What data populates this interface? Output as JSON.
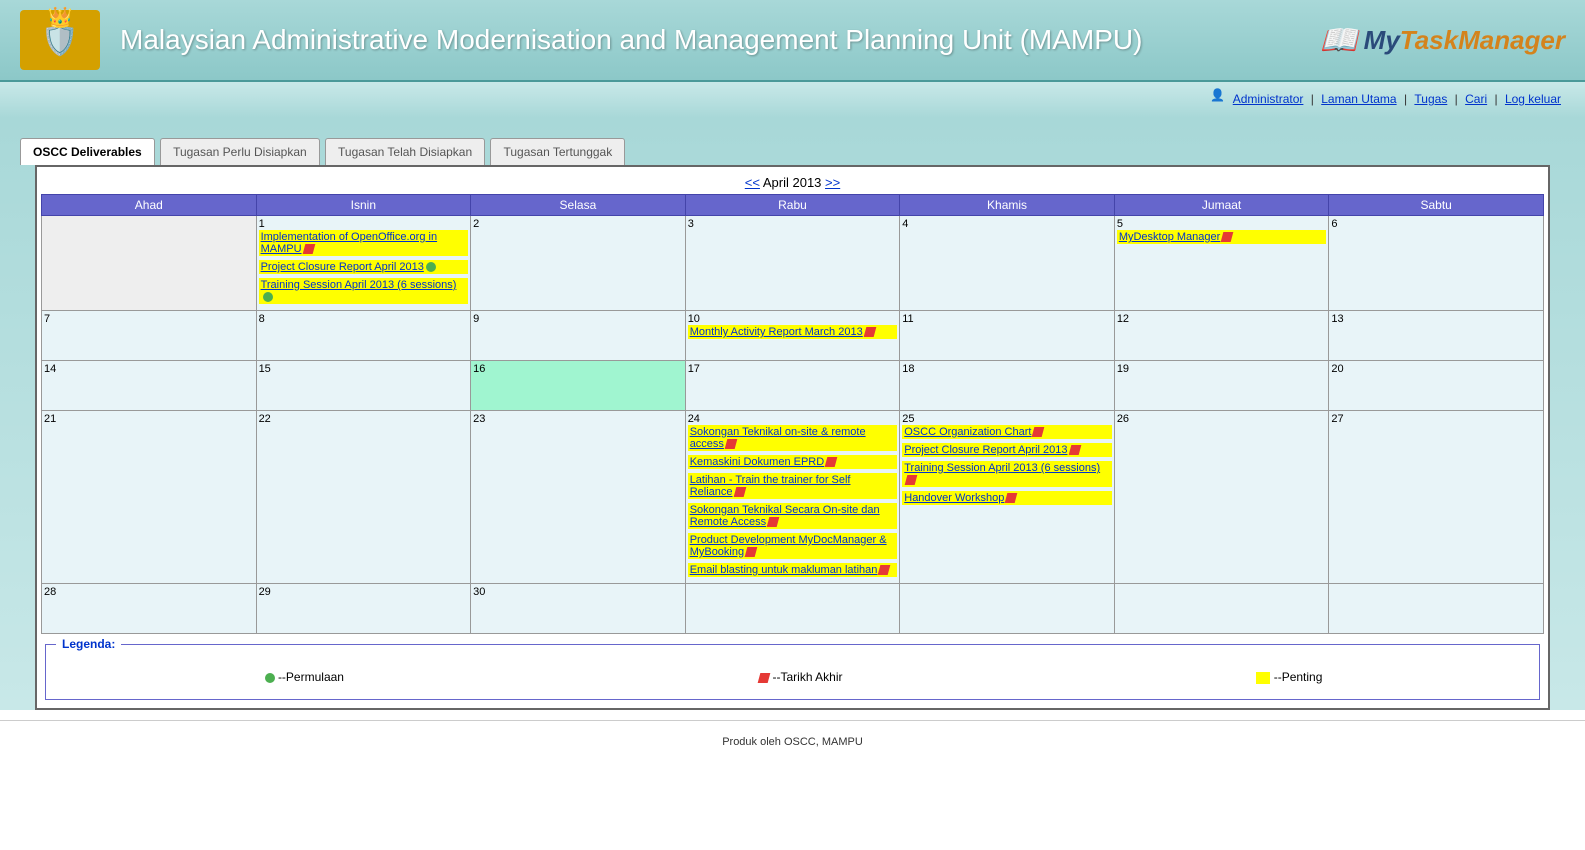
{
  "header": {
    "title": "Malaysian Administrative Modernisation and Management Planning Unit (MAMPU)",
    "logo_my": "My",
    "logo_task": "Task",
    "logo_manager": "Manager"
  },
  "userbar": {
    "admin": "Administrator",
    "home": "Laman Utama",
    "tasks": "Tugas",
    "search": "Cari",
    "logout": "Log keluar"
  },
  "tabs": {
    "t1": "OSCC Deliverables",
    "t2": "Tugasan Perlu Disiapkan",
    "t3": "Tugasan Telah Disiapkan",
    "t4": "Tugasan Tertunggak"
  },
  "calnav": {
    "prev": "<<",
    "label": "April 2013",
    "next": ">>"
  },
  "days": {
    "d0": "Ahad",
    "d1": "Isnin",
    "d2": "Selasa",
    "d3": "Rabu",
    "d4": "Khamis",
    "d5": "Jumaat",
    "d6": "Sabtu"
  },
  "events": {
    "d1a": "Implementation of OpenOffice.org in MAMPU",
    "d1b": "Project Closure Report April 2013",
    "d1c": "Training Session April 2013 (6 sessions)",
    "d5a": "MyDesktop Manager",
    "d10a": "Monthly Activity Report March 2013",
    "d24a": "Sokongan Teknikal on-site & remote access",
    "d24b": "Kemaskini Dokumen EPRD",
    "d24c": "Latihan - Train the trainer for Self Reliance",
    "d24d": "Sokongan Teknikal Secara On-site dan Remote Access",
    "d24e": "Product Development MyDocManager & MyBooking",
    "d24f": "Email blasting untuk makluman latihan",
    "d25a": "OSCC Organization Chart",
    "d25b": "Project Closure Report April 2013",
    "d25c": "Training Session April 2013 (6 sessions)",
    "d25d": "Handover Workshop"
  },
  "legend": {
    "title": "Legenda:",
    "start": "--Permulaan",
    "end": "--Tarikh Akhir",
    "important": "--Penting"
  },
  "footer": {
    "text": "Produk oleh OSCC, MAMPU"
  },
  "nums": {
    "n1": "1",
    "n2": "2",
    "n3": "3",
    "n4": "4",
    "n5": "5",
    "n6": "6",
    "n7": "7",
    "n8": "8",
    "n9": "9",
    "n10": "10",
    "n11": "11",
    "n12": "12",
    "n13": "13",
    "n14": "14",
    "n15": "15",
    "n16": "16",
    "n17": "17",
    "n18": "18",
    "n19": "19",
    "n20": "20",
    "n21": "21",
    "n22": "22",
    "n23": "23",
    "n24": "24",
    "n25": "25",
    "n26": "26",
    "n27": "27",
    "n28": "28",
    "n29": "29",
    "n30": "30"
  }
}
